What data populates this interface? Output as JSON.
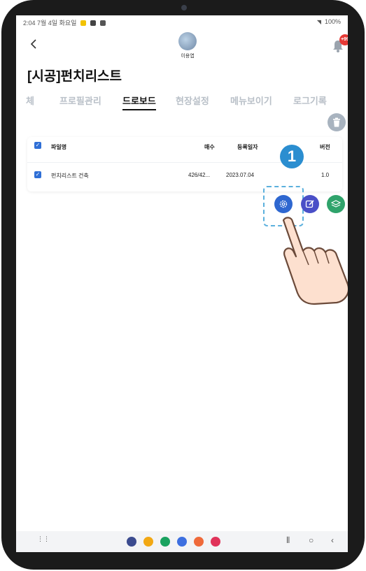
{
  "statusbar": {
    "time_date": "2:04  7월 4일 화요일",
    "battery": "100%"
  },
  "header": {
    "back_label": "<",
    "username": "이용엽",
    "notification_count": "+99"
  },
  "page": {
    "title": "[시공]펀치리스트"
  },
  "tabs": [
    {
      "label": "체"
    },
    {
      "label": "프로필관리"
    },
    {
      "label": "드로보드"
    },
    {
      "label": "현장설정"
    },
    {
      "label": "메뉴보이기"
    },
    {
      "label": "로그기록"
    }
  ],
  "table": {
    "headers": {
      "filename": "파일명",
      "pages": "매수",
      "date": "등록일자",
      "version": "버전"
    },
    "rows": [
      {
        "filename": "펀치리스트 건축",
        "pages": "426/42...",
        "date": "2023.07.04",
        "version": "1.0"
      }
    ]
  },
  "annotation": {
    "step_number": "1"
  },
  "icons": {
    "back": "chevron-left-icon",
    "bell": "bell-icon",
    "trash": "trash-icon",
    "settings": "gear-icon",
    "edit": "edit-icon",
    "layers": "layers-icon"
  },
  "colors": {
    "checkbox": "#2f6fd6",
    "settings_fab": "#2e67d0",
    "edit_fab": "#4a4fc7",
    "layers_fab": "#2fa36b",
    "step_badge": "#2b8ed0",
    "highlight": "#5bb0dd"
  }
}
